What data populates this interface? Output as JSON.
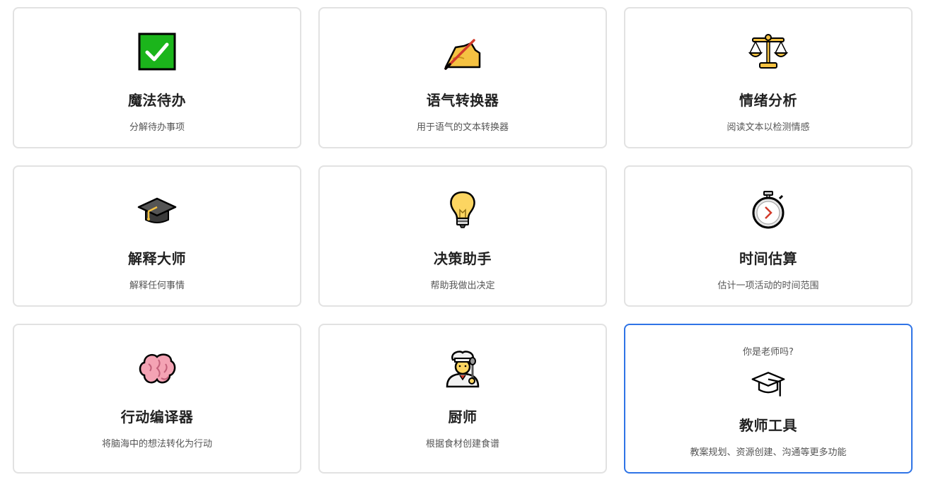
{
  "cards": [
    {
      "icon": "check-box-icon",
      "title": "魔法待办",
      "subtitle": "分解待办事项"
    },
    {
      "icon": "writing-hand-icon",
      "title": "语气转换器",
      "subtitle": "用于语气的文本转换器"
    },
    {
      "icon": "balance-scale-icon",
      "title": "情绪分析",
      "subtitle": "阅读文本以检测情感"
    },
    {
      "icon": "graduation-cap-icon",
      "title": "解释大师",
      "subtitle": "解释任何事情"
    },
    {
      "icon": "light-bulb-icon",
      "title": "决策助手",
      "subtitle": "帮助我做出决定"
    },
    {
      "icon": "stopwatch-icon",
      "title": "时间估算",
      "subtitle": "估计一项活动的时间范围"
    },
    {
      "icon": "brain-icon",
      "title": "行动编译器",
      "subtitle": "将脑海中的想法转化为行动"
    },
    {
      "icon": "cook-icon",
      "title": "厨师",
      "subtitle": "根据食材创建食谱"
    }
  ],
  "teacher": {
    "prompt": "你是老师吗?",
    "icon": "mortarboard-outline-icon",
    "title": "教师工具",
    "subtitle": "教案规划、资源创建、沟通等更多功能",
    "accent": "#2f74e6"
  }
}
